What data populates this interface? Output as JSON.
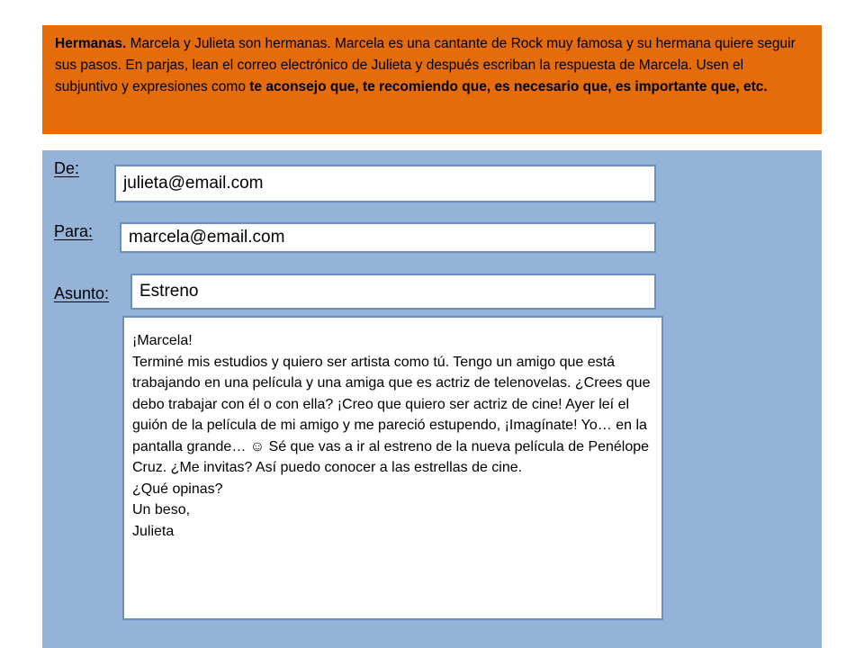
{
  "instructions": {
    "lead": "Hermanas.",
    "text": " Marcela y Julieta son hermanas. Marcela es una cantante de Rock muy famosa y su hermana quiere seguir sus pasos. En parjas, lean el correo electrónico de Julieta y después escriban la respuesta de Marcela. Usen el subjuntivo y expresiones como ",
    "expressions": "te aconsejo que, te recomiendo que, es necesario que, es importante que, etc."
  },
  "email": {
    "from_label": "De:",
    "from_value": "julieta@email.com",
    "to_label": "Para:",
    "to_value": "marcela@email.com",
    "subject_label": "Asunto:",
    "subject_value": "Estreno",
    "body": {
      "greeting": "¡Marcela!",
      "paragraph": "Terminé mis estudios y quiero ser artista como tú. Tengo un amigo que está trabajando en una película y una amiga que es actriz de telenovelas. ¿Crees que debo trabajar con él o con ella? ¡Creo que quiero ser actriz de cine! Ayer leí el guión de la película de mi amigo y me pareció estupendo, ¡Imagínate! Yo… en la pantalla grande…  ☺ Sé que vas a ir al estreno de la nueva película de Penélope Cruz. ¿Me invitas? Así puedo conocer a las estrellas de cine.",
      "question": "¿Qué opinas?",
      "closing": "Un beso,",
      "signature": "Julieta"
    }
  }
}
